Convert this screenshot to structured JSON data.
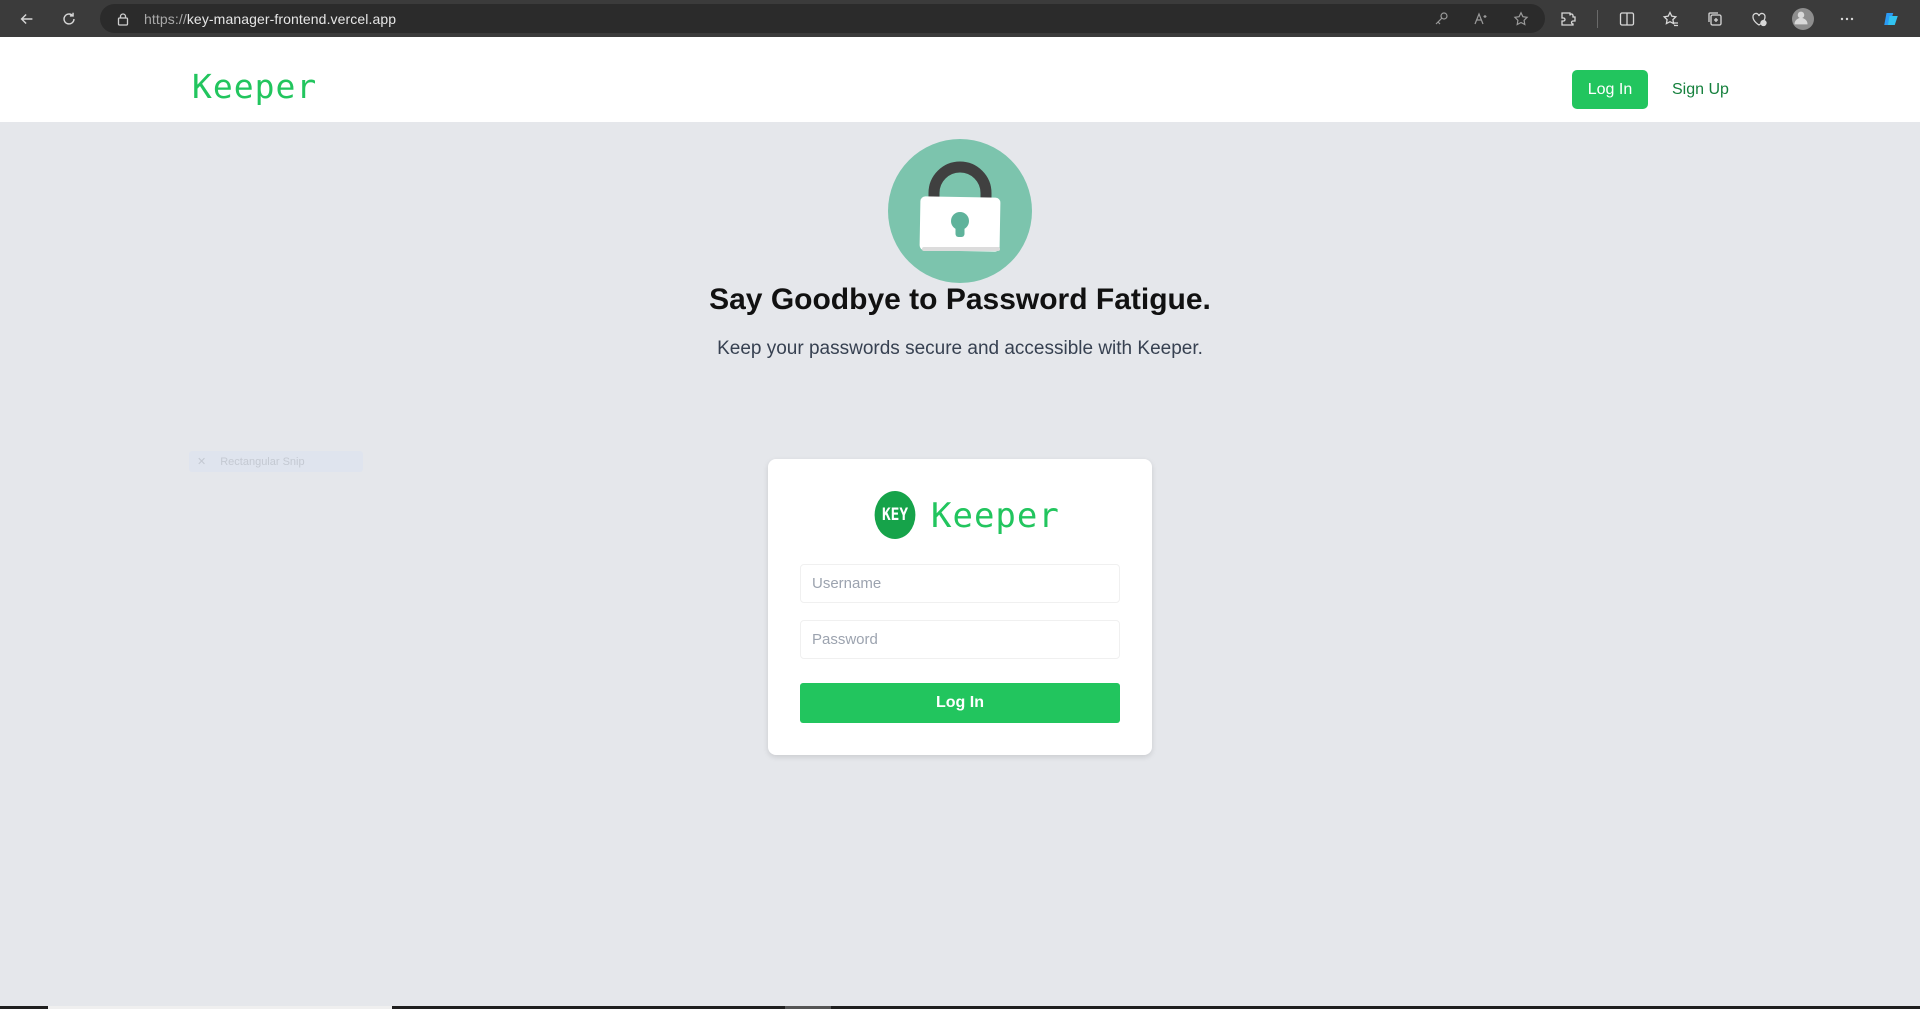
{
  "browser": {
    "url_scheme": "https://",
    "url_host": "key-manager-frontend.vercel.app"
  },
  "header": {
    "brand": "Keeper",
    "login_label": "Log In",
    "signup_label": "Sign Up"
  },
  "hero": {
    "title": "Say Goodbye to Password Fatigue.",
    "subtitle": "Keep your passwords secure and accessible with Keeper."
  },
  "snip_overlay": {
    "label": "Rectangular Snip"
  },
  "login_card": {
    "logo_text": "KEY",
    "brand": "Keeper",
    "username_placeholder": "Username",
    "password_placeholder": "Password",
    "submit_label": "Log In"
  },
  "colors": {
    "accent": "#22c55e",
    "accent_dark": "#16a34a",
    "page_bg": "#e5e7eb",
    "lock_circle": "#7cc4ad"
  }
}
